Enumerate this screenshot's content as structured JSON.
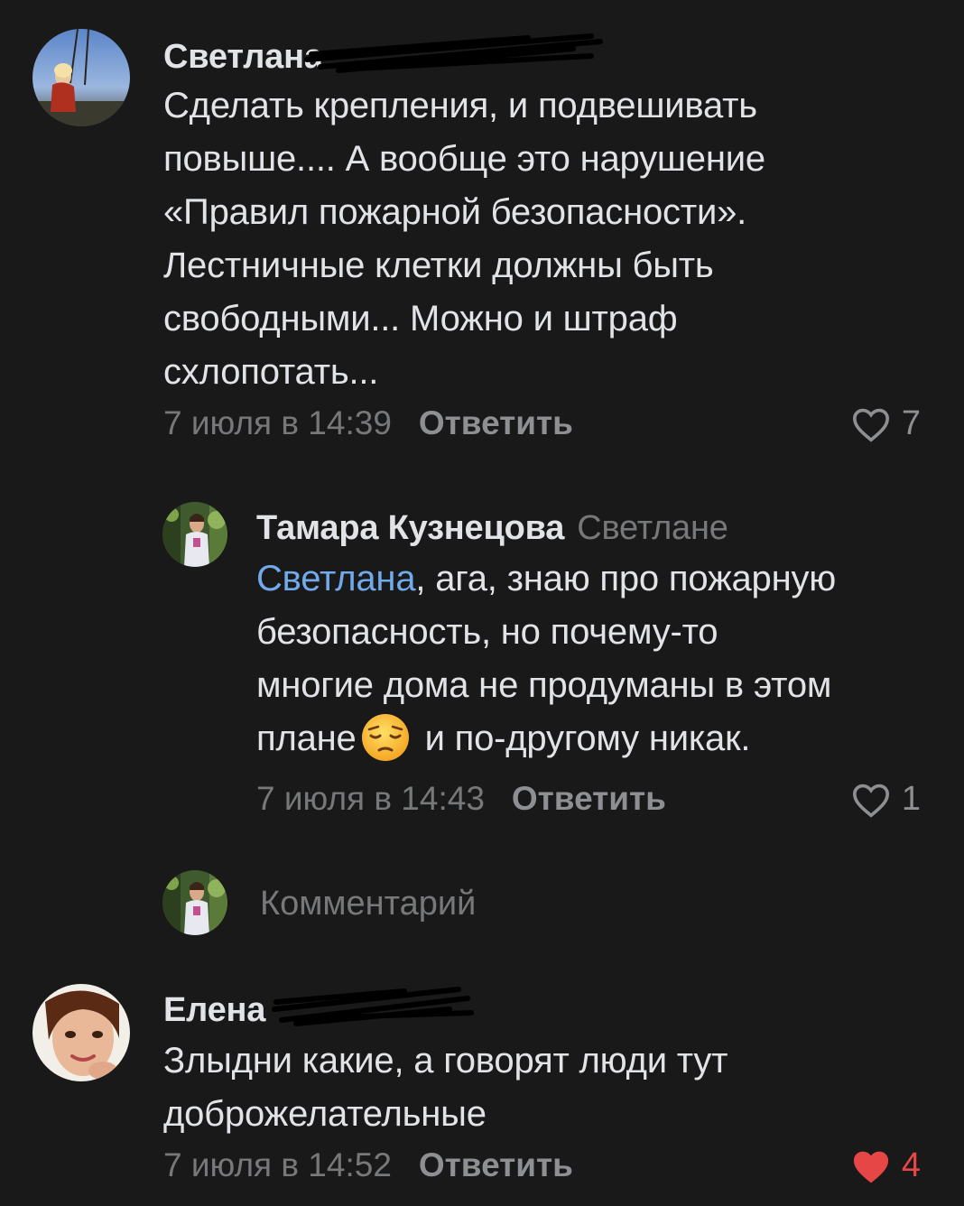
{
  "comments": [
    {
      "author": "Светлана",
      "text_lines": [
        "Сделать крепления, и подвешивать",
        "повыше.... А вообще это нарушение",
        "«Правил пожарной безопасности».",
        "Лестничные клетки должны быть",
        "свободными... Можно и штраф",
        "схлопотать..."
      ],
      "date": "7 июля в 14:39",
      "reply_label": "Ответить",
      "likes": "7",
      "liked": false
    },
    {
      "author": "Тамара Кузнецова",
      "reply_to": "Светлане",
      "mention": "Светлана",
      "text_first_rest": ", ага, знаю про пожарную",
      "text_lines": [
        "безопасность, но почему-то",
        "многие дома не продуманы в этом"
      ],
      "text_last_before_emoji": "плане",
      "emoji": "pensive-face",
      "text_last_after_emoji": "и по-другому никак.",
      "date": "7 июля в 14:43",
      "reply_label": "Ответить",
      "likes": "1",
      "liked": false
    },
    {
      "author": "Елена",
      "text_lines": [
        "Злыдни какие, а говорят люди тут",
        "доброжелательные"
      ],
      "date": "7 июля в 14:52",
      "reply_label": "Ответить",
      "likes": "4",
      "liked": true
    }
  ],
  "composer": {
    "placeholder": "Комментарий"
  },
  "colors": {
    "background": "#19191a",
    "text": "#e1e3e6",
    "secondary": "#76787a",
    "mention": "#71aaeb",
    "like_active": "#e64646"
  },
  "icons": [
    "heart-outline-icon",
    "heart-filled-icon",
    "pensive-face-emoji"
  ]
}
